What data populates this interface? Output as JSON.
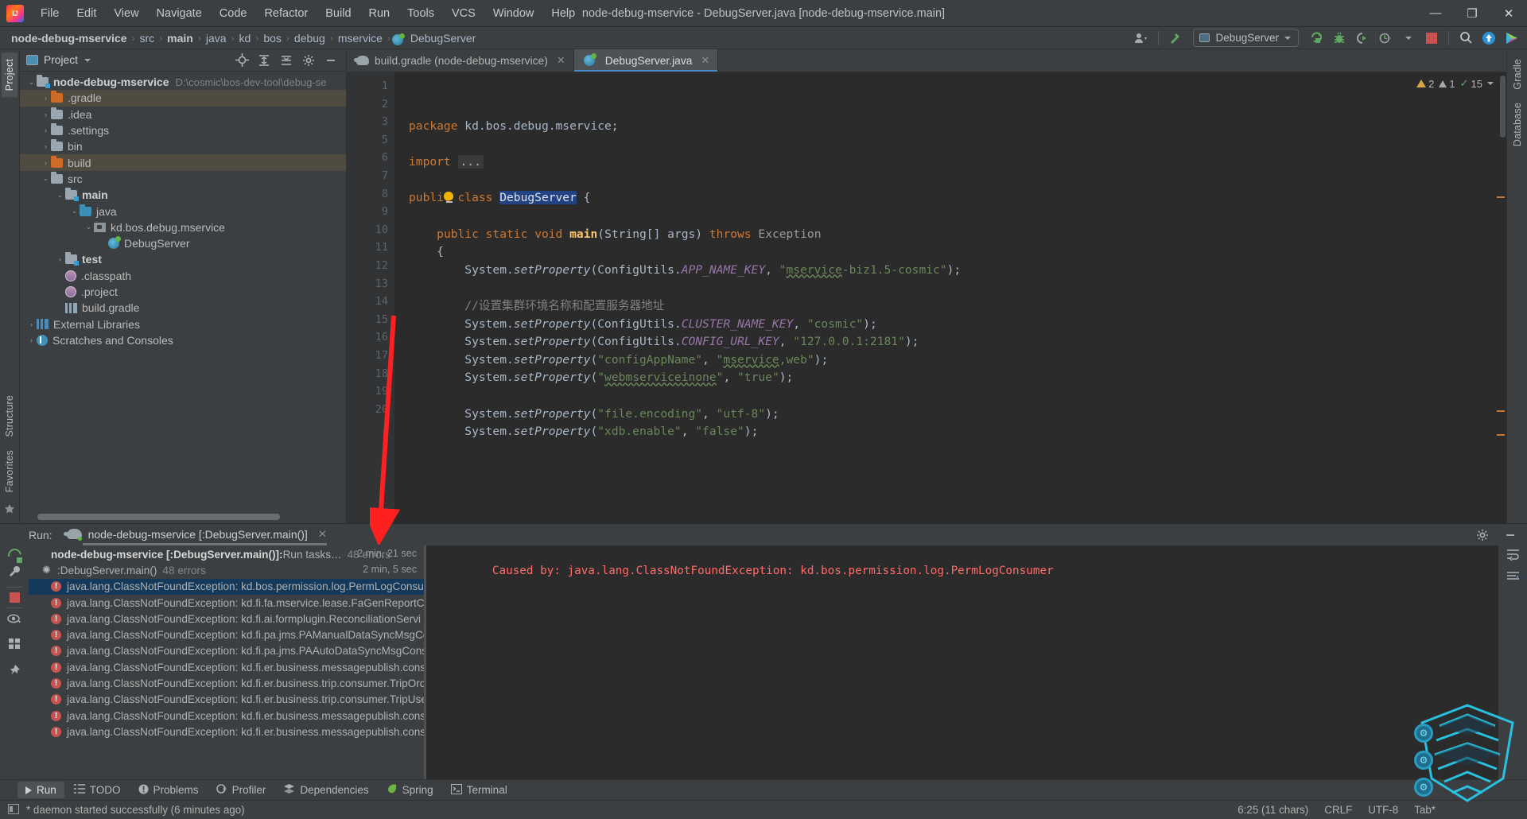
{
  "window": {
    "title": "node-debug-mservice - DebugServer.java [node-debug-mservice.main]",
    "minimize": "—",
    "maximize": "❐",
    "close": "✕"
  },
  "menu": [
    "File",
    "Edit",
    "View",
    "Navigate",
    "Code",
    "Refactor",
    "Build",
    "Run",
    "Tools",
    "VCS",
    "Window",
    "Help"
  ],
  "breadcrumb": {
    "items": [
      "node-debug-mservice",
      "src",
      "main",
      "java",
      "kd",
      "bos",
      "debug",
      "mservice",
      "DebugServer"
    ],
    "separator": "›"
  },
  "toolbar": {
    "run_configuration": "DebugServer",
    "icons": [
      "user-icon",
      "build-hammer-icon",
      "run-icon",
      "debug-icon",
      "run-coverage-icon",
      "profiler-icon",
      "stop-icon",
      "search-icon",
      "update-icon",
      "ide-icon"
    ]
  },
  "left_strip": {
    "tabs": [
      "Project",
      "Structure",
      "Favorites"
    ]
  },
  "right_strip": {
    "tabs": [
      "Gradle",
      "Database"
    ]
  },
  "project_panel": {
    "title": "Project",
    "tree": [
      {
        "label": "node-debug-mservice",
        "path": "D:\\cosmic\\bos-dev-tool\\debug-se",
        "indent": 0,
        "arrow": "⌄",
        "icon": "module-folder",
        "bold": true,
        "highlight": false
      },
      {
        "label": ".gradle",
        "path": "",
        "indent": 1,
        "arrow": "›",
        "icon": "folder-orange",
        "bold": false,
        "highlight": true
      },
      {
        "label": ".idea",
        "path": "",
        "indent": 1,
        "arrow": "›",
        "icon": "folder-gray",
        "bold": false,
        "highlight": false
      },
      {
        "label": ".settings",
        "path": "",
        "indent": 1,
        "arrow": "›",
        "icon": "folder-gray",
        "bold": false,
        "highlight": false
      },
      {
        "label": "bin",
        "path": "",
        "indent": 1,
        "arrow": "›",
        "icon": "folder-gray",
        "bold": false,
        "highlight": false
      },
      {
        "label": "build",
        "path": "",
        "indent": 1,
        "arrow": "›",
        "icon": "folder-orange",
        "bold": false,
        "highlight": true
      },
      {
        "label": "src",
        "path": "",
        "indent": 1,
        "arrow": "⌄",
        "icon": "folder-gray",
        "bold": false,
        "highlight": false
      },
      {
        "label": "main",
        "path": "",
        "indent": 2,
        "arrow": "⌄",
        "icon": "folder-source",
        "bold": true,
        "highlight": false
      },
      {
        "label": "java",
        "path": "",
        "indent": 3,
        "arrow": "⌄",
        "icon": "folder-blue",
        "bold": false,
        "highlight": false
      },
      {
        "label": "kd.bos.debug.mservice",
        "path": "",
        "indent": 4,
        "arrow": "⌄",
        "icon": "package-icon",
        "bold": false,
        "highlight": false
      },
      {
        "label": "DebugServer",
        "path": "",
        "indent": 5,
        "arrow": "",
        "icon": "class-icon",
        "bold": false,
        "highlight": false
      },
      {
        "label": "test",
        "path": "",
        "indent": 2,
        "arrow": "›",
        "icon": "folder-source",
        "bold": true,
        "highlight": false
      },
      {
        "label": ".classpath",
        "path": "",
        "indent": 2,
        "arrow": "",
        "icon": "globe-purple",
        "bold": false,
        "highlight": false
      },
      {
        "label": ".project",
        "path": "",
        "indent": 2,
        "arrow": "",
        "icon": "globe-purple",
        "bold": false,
        "highlight": false
      },
      {
        "label": "build.gradle",
        "path": "",
        "indent": 2,
        "arrow": "",
        "icon": "gradle-icon",
        "bold": false,
        "highlight": false
      },
      {
        "label": "External Libraries",
        "path": "",
        "indent": 0,
        "arrow": "›",
        "icon": "library-icon",
        "bold": false,
        "highlight": false
      },
      {
        "label": "Scratches and Consoles",
        "path": "",
        "indent": 0,
        "arrow": "›",
        "icon": "scratch-icon",
        "bold": false,
        "highlight": false
      }
    ]
  },
  "editor": {
    "tabs": [
      {
        "label": "build.gradle (node-debug-mservice)",
        "icon": "gradle-icon",
        "active": false,
        "close": "✕"
      },
      {
        "label": "DebugServer.java",
        "icon": "class-icon",
        "active": true,
        "close": "✕"
      }
    ],
    "inspections": {
      "warnings": "2",
      "weak_warnings": "1",
      "checks": "15",
      "caret": "⌄"
    },
    "line_numbers": [
      "1",
      "2",
      "3",
      "5",
      "6",
      "7",
      "8",
      "9",
      "10",
      "11",
      "12",
      "13",
      "14",
      "15",
      "16",
      "17",
      "18",
      "19",
      "20"
    ],
    "code_lines": [
      {
        "n": "1",
        "html": "<span class=\"kw\">package</span> kd.bos.debug.mservice;"
      },
      {
        "n": "2",
        "html": ""
      },
      {
        "n": "3",
        "html": "<span class=\"kw\">import</span> <span class=\"importbox\">...</span>"
      },
      {
        "n": "5",
        "html": ""
      },
      {
        "n": "6",
        "html": "<span class=\"kw\">public class</span> <span class=\"sel\">DebugServer</span> {"
      },
      {
        "n": "7",
        "html": ""
      },
      {
        "n": "8",
        "html": "    <span class=\"kw\">public static</span> <span class=\"kw\">void</span> <span class=\"mth\"><b>main</b></span>(String[] args) <span class=\"kw\">throws</span> <span class=\"typ\" style=\"color:#9b9b9b\">Exception</span>"
      },
      {
        "n": "9",
        "html": "    {"
      },
      {
        "n": "10",
        "html": "        System.<span class=\"meth-it\">setProperty</span>(ConfigUtils.<span class=\"fld\">APP_NAME_KEY</span>, <span class=\"str\">\"<span class=\"squigw\">mservice</span>-biz1.5-cosmic\"</span>);"
      },
      {
        "n": "11",
        "html": ""
      },
      {
        "n": "12",
        "html": "        <span class=\"cmt\">//设置集群环境名称和配置服务器地址</span>"
      },
      {
        "n": "13",
        "html": "        System.<span class=\"meth-it\">setProperty</span>(ConfigUtils.<span class=\"fld\">CLUSTER_NAME_KEY</span>, <span class=\"str\">\"cosmic\"</span>);"
      },
      {
        "n": "14",
        "html": "        System.<span class=\"meth-it\">setProperty</span>(ConfigUtils.<span class=\"fld\">CONFIG_URL_KEY</span>, <span class=\"str\">\"127.0.0.1:2181\"</span>);"
      },
      {
        "n": "15",
        "html": "        System.<span class=\"meth-it\">setProperty</span>(<span class=\"str\">\"configAppName\"</span>, <span class=\"str\">\"<span class=\"squigw\">mservice</span>,web\"</span>);"
      },
      {
        "n": "16",
        "html": "        System.<span class=\"meth-it\">setProperty</span>(<span class=\"str\">\"<span class=\"squigw\">webmserviceinone</span>\"</span>, <span class=\"str\">\"true\"</span>);"
      },
      {
        "n": "17",
        "html": ""
      },
      {
        "n": "18",
        "html": "        System.<span class=\"meth-it\">setProperty</span>(<span class=\"str\">\"file.encoding\"</span>, <span class=\"str\">\"utf-8\"</span>);"
      },
      {
        "n": "19",
        "html": "        System.<span class=\"meth-it\">setProperty</span>(<span class=\"str\">\"xdb.enable\"</span>, <span class=\"str\">\"false\"</span>);"
      },
      {
        "n": "20",
        "html": ""
      }
    ]
  },
  "run_panel": {
    "label": "Run:",
    "tab_title": "node-debug-mservice [:DebugServer.main()]",
    "tab_close": "✕",
    "tree": [
      {
        "type": "root",
        "bold_text": "node-debug-mservice [:DebugServer.main()]:",
        "text": " Run tasks…",
        "dim": "48 errors",
        "time": "2 min, 21 sec",
        "selected": false
      },
      {
        "type": "task",
        "bold_text": "",
        "text": ":DebugServer.main()",
        "dim": "48 errors",
        "time": "2 min, 5 sec",
        "selected": false
      },
      {
        "type": "error",
        "text": "java.lang.ClassNotFoundException: kd.bos.permission.log.PermLogConsu",
        "time": "",
        "selected": true
      },
      {
        "type": "error",
        "text": "java.lang.ClassNotFoundException: kd.fi.fa.mservice.lease.FaGenReportCo",
        "time": "",
        "selected": false
      },
      {
        "type": "error",
        "text": "java.lang.ClassNotFoundException: kd.fi.ai.formplugin.ReconciliationServi",
        "time": "",
        "selected": false
      },
      {
        "type": "error",
        "text": "java.lang.ClassNotFoundException: kd.fi.pa.jms.PAManualDataSyncMsgCo",
        "time": "",
        "selected": false
      },
      {
        "type": "error",
        "text": "java.lang.ClassNotFoundException: kd.fi.pa.jms.PAAutoDataSyncMsgCons",
        "time": "",
        "selected": false
      },
      {
        "type": "error",
        "text": "java.lang.ClassNotFoundException: kd.fi.er.business.messagepublish.cons",
        "time": "",
        "selected": false
      },
      {
        "type": "error",
        "text": "java.lang.ClassNotFoundException: kd.fi.er.business.trip.consumer.TripOrd",
        "time": "",
        "selected": false
      },
      {
        "type": "error",
        "text": "java.lang.ClassNotFoundException: kd.fi.er.business.trip.consumer.TripUse",
        "time": "",
        "selected": false
      },
      {
        "type": "error",
        "text": "java.lang.ClassNotFoundException: kd.fi.er.business.messagepublish.cons",
        "time": "",
        "selected": false
      },
      {
        "type": "error",
        "text": "java.lang.ClassNotFoundException: kd.fi.er.business.messagepublish.cons",
        "time": "",
        "selected": false
      }
    ],
    "console_text": "Caused by: java.lang.ClassNotFoundException: kd.bos.permission.log.PermLogConsumer"
  },
  "bottom_tabs": [
    {
      "label": "Run",
      "icon": "run-icon",
      "selected": true
    },
    {
      "label": "TODO",
      "icon": "todo-icon",
      "selected": false
    },
    {
      "label": "Problems",
      "icon": "problems-icon",
      "selected": false
    },
    {
      "label": "Profiler",
      "icon": "profiler-icon",
      "selected": false
    },
    {
      "label": "Dependencies",
      "icon": "dependencies-icon",
      "selected": false
    },
    {
      "label": "Spring",
      "icon": "spring-icon",
      "selected": false
    },
    {
      "label": "Terminal",
      "icon": "terminal-icon",
      "selected": false
    }
  ],
  "status_bar": {
    "message": "* daemon started successfully (6 minutes ago)",
    "caret_position": "6:25 (11 chars)",
    "line_separator": "CRLF",
    "encoding": "UTF-8",
    "indent": "Tab*"
  },
  "colors": {
    "accent": "#4a88c7",
    "error": "#c75450",
    "console_error": "#ff6b68",
    "annotation_arrow": "#ff2020",
    "panel_bg": "#3c3f41",
    "editor_bg": "#2b2b2b",
    "selection": "#15395b"
  }
}
